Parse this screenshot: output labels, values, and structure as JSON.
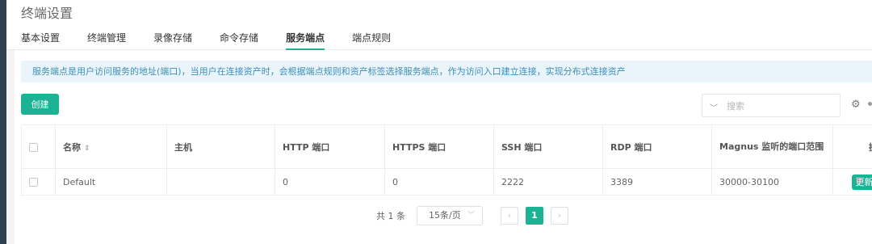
{
  "page_title": "终端设置",
  "tabs": [
    "基本设置",
    "终端管理",
    "录像存储",
    "命令存储",
    "服务端点",
    "端点规则"
  ],
  "info_text": "服务端点是用户访问服务的地址(端口)，当用户在连接资产时，会根据端点规则和资产标签选择服务端点，作为访问入口建立连接，实现分布式连接资产",
  "create_label": "创建",
  "search": {
    "placeholder": "搜索"
  },
  "table": {
    "headers": {
      "name": "名称",
      "host": "主机",
      "http": "HTTP 端口",
      "https": "HTTPS 端口",
      "ssh": "SSH 端口",
      "rdp": "RDP 端口",
      "magnus": "Magnus 监听的端口范围",
      "actions": "操"
    },
    "rows": [
      {
        "name": "Default",
        "host": "",
        "http": "0",
        "https": "0",
        "ssh": "2222",
        "rdp": "3389",
        "magnus": "30000-30100",
        "action_label": "更新"
      }
    ]
  },
  "pagination": {
    "total": "共 1 条",
    "page_size": "15条/页",
    "current_page": "1"
  },
  "colors": {
    "accent": "#1ab394",
    "info_bg": "#eaf5fb",
    "info_text": "#3d8eb9"
  }
}
